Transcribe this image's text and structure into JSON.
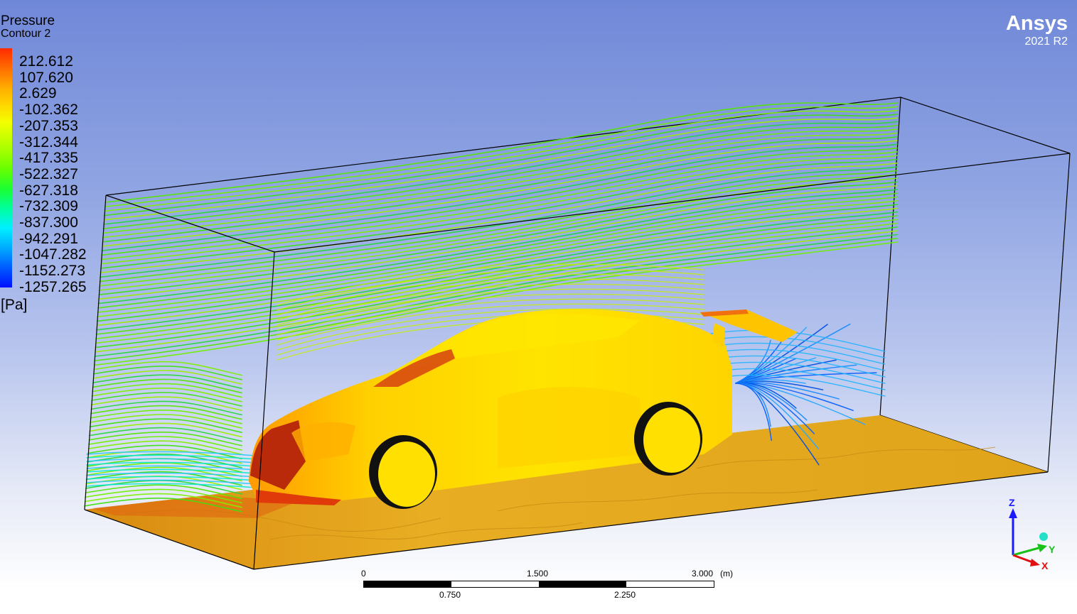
{
  "legend": {
    "title": "Pressure",
    "subtitle": "Contour 2",
    "labels": [
      "212.612",
      "107.620",
      "2.629",
      "-102.362",
      "-207.353",
      "-312.344",
      "-417.335",
      "-522.327",
      "-627.318",
      "-732.309",
      "-837.300",
      "-942.291",
      "-1047.282",
      "-1152.273",
      "-1257.265"
    ],
    "unit": "[Pa]"
  },
  "brand": {
    "name": "Ansys",
    "version": "2021 R2"
  },
  "scale": {
    "top_ticks": [
      "0",
      "1.500",
      "3.000"
    ],
    "unit": "(m)",
    "bottom_ticks": [
      "0.750",
      "2.250"
    ]
  },
  "triad": {
    "z": "Z",
    "y": "Y",
    "x": "X"
  },
  "colors": {
    "axis_z": "#1a1aff",
    "axis_y": "#18c018",
    "axis_x": "#e01010",
    "floor": "#e0a81c",
    "car_body": "#ffdc00",
    "streamline_top": "#6ff000",
    "streamline_wake": "#1a8cff"
  }
}
